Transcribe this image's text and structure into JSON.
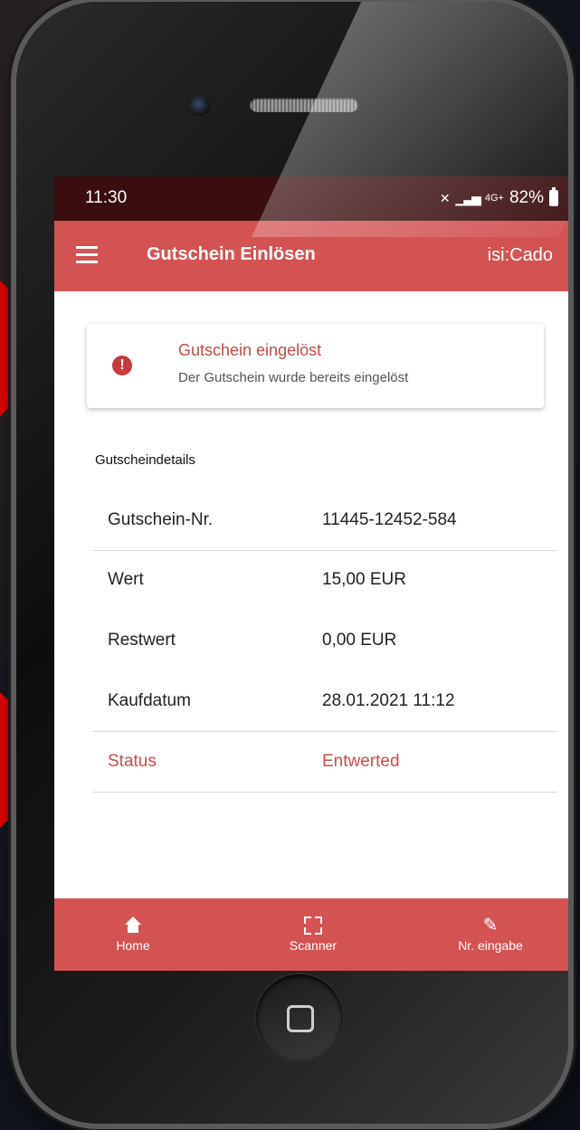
{
  "statusbar": {
    "time": "11:30",
    "signal": "4G+",
    "battery": "82%"
  },
  "appbar": {
    "title": "Gutschein Einlösen",
    "brand": "isi:Cado",
    "menu_icon": "menu-icon"
  },
  "alert": {
    "icon": "error-icon",
    "title": "Gutschein eingelöst",
    "message": "Der Gutschein wurde bereits eingelöst"
  },
  "details": {
    "section_title": "Gutscheindetails",
    "rows": [
      {
        "label": "Gutschein-Nr.",
        "value": "11445-12452-584"
      },
      {
        "label": "Wert",
        "value": "15,00 EUR"
      },
      {
        "label": "Restwert",
        "value": "0,00 EUR"
      },
      {
        "label": "Kaufdatum",
        "value": "28.01.2021 11:12"
      },
      {
        "label": "Status",
        "value": "Entwerted"
      }
    ]
  },
  "bottomnav": {
    "items": [
      {
        "label": "Home",
        "icon": "home-icon"
      },
      {
        "label": "Scanner",
        "icon": "scan-icon"
      },
      {
        "label": "Nr. eingabe",
        "icon": "pencil-icon"
      }
    ]
  },
  "colors": {
    "accent": "#d35353",
    "statusbar": "#3a0d0e",
    "status_text": "#cc4b4b",
    "annotation_arrow": "#ee0000"
  }
}
